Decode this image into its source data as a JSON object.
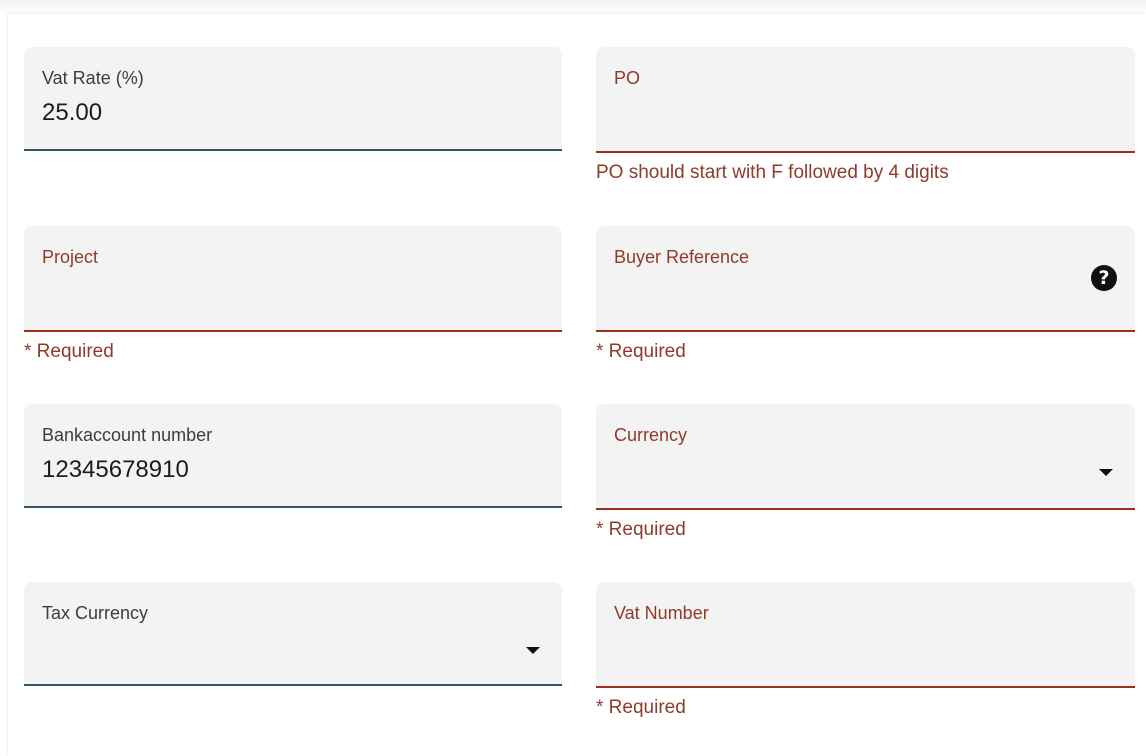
{
  "form": {
    "vat_rate": {
      "label": "Vat Rate (%)",
      "value": "25.00"
    },
    "po": {
      "label": "PO",
      "value": "",
      "error": "PO should start with F followed by 4 digits"
    },
    "project": {
      "label": "Project",
      "value": "",
      "error": "* Required"
    },
    "buyer_reference": {
      "label": "Buyer Reference",
      "value": "",
      "error": "* Required",
      "help_icon": "?"
    },
    "bankaccount_number": {
      "label": "Bankaccount number",
      "value": "12345678910"
    },
    "currency": {
      "label": "Currency",
      "value": "",
      "error": "* Required"
    },
    "tax_currency": {
      "label": "Tax Currency",
      "value": ""
    },
    "vat_number": {
      "label": "Vat Number",
      "value": "",
      "error": "* Required"
    }
  },
  "colors": {
    "field_background": "#f3f3f3",
    "valid_underline": "#2e5668",
    "error_underline": "#9e2f18",
    "error_text": "#8f3b2a"
  },
  "icons": {
    "help": "question-circle-icon",
    "dropdown": "caret-down-icon"
  }
}
